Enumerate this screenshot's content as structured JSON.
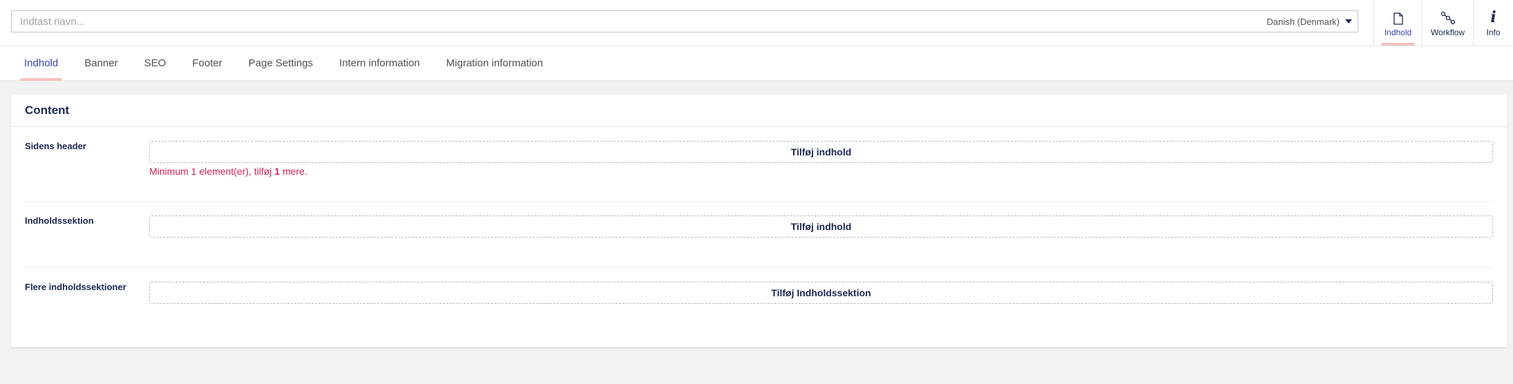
{
  "header": {
    "name_placeholder": "Indtast navn...",
    "language": "Danish (Denmark)",
    "apps": [
      {
        "label": "Indhold",
        "icon": "document-icon",
        "active": true
      },
      {
        "label": "Workflow",
        "icon": "workflow-icon",
        "active": false
      },
      {
        "label": "Info",
        "icon": "info-icon",
        "active": false
      }
    ]
  },
  "tabs": [
    {
      "label": "Indhold",
      "active": true
    },
    {
      "label": "Banner"
    },
    {
      "label": "SEO"
    },
    {
      "label": "Footer"
    },
    {
      "label": "Page Settings"
    },
    {
      "label": "Intern information"
    },
    {
      "label": "Migration information"
    }
  ],
  "panel": {
    "title": "Content",
    "properties": [
      {
        "label": "Sidens header",
        "button": "Tilføj indhold",
        "validation_prefix": "Minimum 1 element(er), tilføj ",
        "validation_count": "1",
        "validation_suffix": " mere."
      },
      {
        "label": "Indholdssektion",
        "button": "Tilføj indhold"
      },
      {
        "label": "Flere indholdssektioner",
        "button": "Tilføj Indholdssektion"
      }
    ]
  },
  "colors": {
    "accent": "#3544b1",
    "active_indicator": "#f5c1bc",
    "validation": "#d42054",
    "text": "#1b264f"
  }
}
